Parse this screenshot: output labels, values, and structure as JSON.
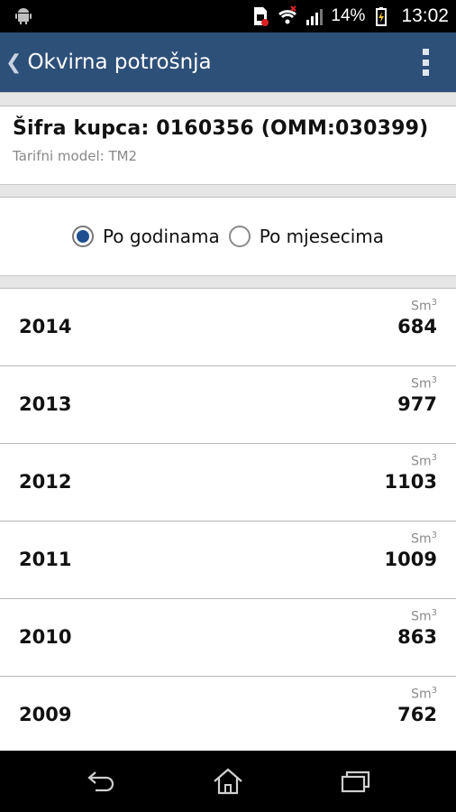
{
  "status_bar": {
    "battery_percent": "14%",
    "time": "13:02",
    "icons": [
      "android-icon",
      "sim-icon",
      "wifi-icon",
      "signal-icon",
      "battery-icon"
    ]
  },
  "action_bar": {
    "title": "Okvirna potrošnja",
    "back_icon": "chevron-left-icon",
    "overflow_icon": "overflow-menu-icon"
  },
  "customer": {
    "id_line": "Šifra kupca: 0160356 (OMM:030399)",
    "tariff_line": "Tarifni model: TM2"
  },
  "view_mode": {
    "options": [
      {
        "label": "Po godinama",
        "checked": true
      },
      {
        "label": "Po mjesecima",
        "checked": false
      }
    ]
  },
  "consumption": {
    "unit": "Sm",
    "unit_exp": "3",
    "rows": [
      {
        "year": "2014",
        "value": "684"
      },
      {
        "year": "2013",
        "value": "977"
      },
      {
        "year": "2012",
        "value": "1103"
      },
      {
        "year": "2011",
        "value": "1009"
      },
      {
        "year": "2010",
        "value": "863"
      },
      {
        "year": "2009",
        "value": "762"
      }
    ]
  },
  "nav_bar": {
    "buttons": [
      "back-icon",
      "home-icon",
      "recents-icon"
    ]
  },
  "colors": {
    "action_bar": "#2d5079",
    "radio_checked": "#1f4f8f"
  }
}
